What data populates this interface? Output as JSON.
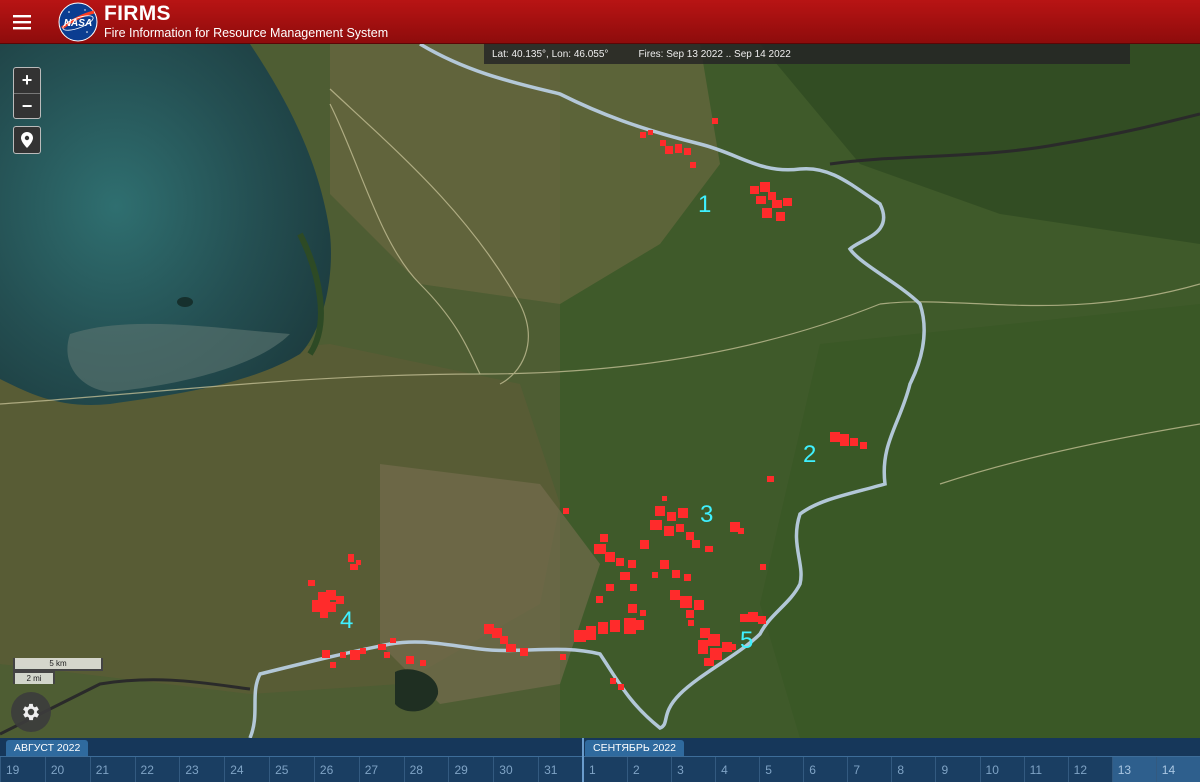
{
  "header": {
    "title": "FIRMS",
    "subtitle": "Fire Information for Resource Management System",
    "logo_text": "NASA"
  },
  "infobar": {
    "coords": "Lat: 40.135°, Lon: 46.055°",
    "fires": "Fires: Sep 13 2022 .. Sep 14 2022"
  },
  "map": {
    "cluster_labels": [
      "1",
      "2",
      "3",
      "4",
      "5"
    ],
    "label_color": "#3ff0ff",
    "fire_color": "#ff2b2b",
    "border_color": "#b8cde0"
  },
  "controls": {
    "zoom_in": "+",
    "zoom_out": "−",
    "locate_icon": "location-pin-icon",
    "settings_icon": "gear-icon"
  },
  "scale": {
    "km": "5 km",
    "mi": "2 mi"
  },
  "timeline": {
    "months": [
      "АВГУСТ 2022",
      "СЕНТЯБРЬ 2022"
    ],
    "aug_days": [
      "19",
      "20",
      "21",
      "22",
      "23",
      "24",
      "25",
      "26",
      "27",
      "28",
      "29",
      "30",
      "31"
    ],
    "sep_days": [
      "1",
      "2",
      "3",
      "4",
      "5",
      "6",
      "7",
      "8",
      "9",
      "10",
      "11",
      "12",
      "13",
      "14"
    ],
    "selected_days": [
      "13",
      "14"
    ]
  },
  "colors": {
    "header_red": "#a51010",
    "timeline_bg": "#1a3e62"
  }
}
